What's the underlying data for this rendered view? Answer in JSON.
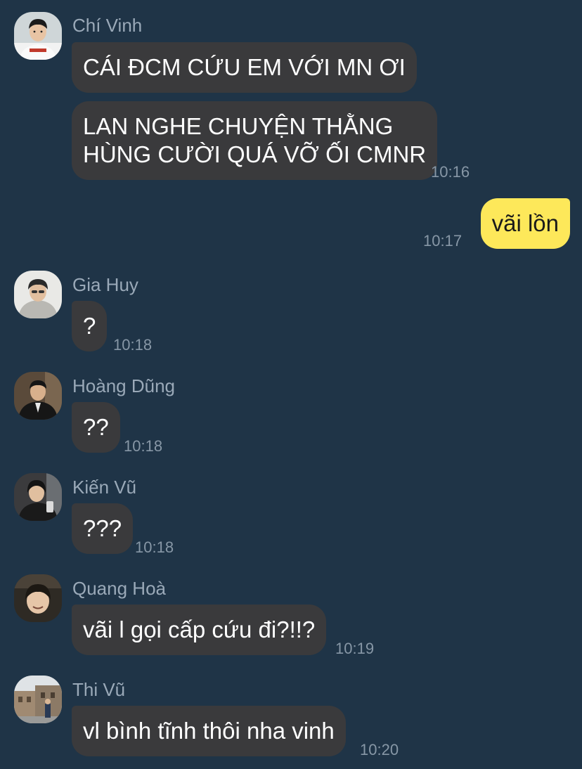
{
  "messages": [
    {
      "sender": "Chí Vinh",
      "avatar_icon": "avatar-chi-vinh",
      "bubbles": [
        {
          "lines": [
            "CÁI ĐCM CỨU EM VỚI MN ƠI"
          ]
        },
        {
          "lines": [
            "LAN NGHE CHUYỆN THẰNG",
            "HÙNG CƯỜI QUÁ VỠ ỐI CMNR"
          ]
        }
      ],
      "time": "10:16"
    },
    {
      "sender": "",
      "outgoing": true,
      "bubbles": [
        {
          "lines": [
            "vãi lồn"
          ]
        }
      ],
      "time": "10:17"
    },
    {
      "sender": "Gia Huy",
      "avatar_icon": "avatar-gia-huy",
      "bubbles": [
        {
          "lines": [
            "?"
          ]
        }
      ],
      "time": "10:18"
    },
    {
      "sender": "Hoàng Dũng",
      "avatar_icon": "avatar-hoang-dung",
      "bubbles": [
        {
          "lines": [
            "??"
          ]
        }
      ],
      "time": "10:18"
    },
    {
      "sender": "Kiến Vũ",
      "avatar_icon": "avatar-kien-vu",
      "bubbles": [
        {
          "lines": [
            "???"
          ]
        }
      ],
      "time": "10:18"
    },
    {
      "sender": "Quang Hoà",
      "avatar_icon": "avatar-quang-hoa",
      "bubbles": [
        {
          "lines": [
            "vãi l gọi cấp cứu đi?!!?"
          ]
        }
      ],
      "time": "10:19"
    },
    {
      "sender": "Thi Vũ",
      "avatar_icon": "avatar-thi-vu",
      "bubbles": [
        {
          "lines": [
            "vl bình tĩnh thôi nha vinh"
          ]
        }
      ],
      "time": "10:20"
    }
  ],
  "colors": {
    "background": "#1f3447",
    "incoming_bubble": "#3a3a3c",
    "outgoing_bubble": "#fde85a",
    "sender_name": "#9aa9b8",
    "timestamp": "#8797a6"
  }
}
